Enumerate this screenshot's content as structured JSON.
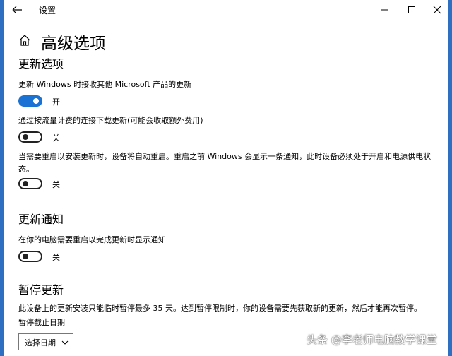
{
  "window": {
    "title": "设置"
  },
  "header": {
    "page_title": "高级选项"
  },
  "update_options": {
    "heading": "更新选项",
    "items": [
      {
        "description": "更新 Windows 时接收其他 Microsoft 产品的更新",
        "state": "on",
        "state_label": "开"
      },
      {
        "description": "通过按流量计费的连接下载更新(可能会收取额外费用)",
        "state": "off",
        "state_label": "关"
      },
      {
        "description": "当需要重启以安装更新时，设备将自动重启。重启之前 Windows 会显示一条通知，此时设备必须处于开启和电源供电状态。",
        "state": "off",
        "state_label": "关"
      }
    ]
  },
  "update_notifications": {
    "heading": "更新通知",
    "items": [
      {
        "description": "在你的电脑需要重启以完成更新时显示通知",
        "state": "off",
        "state_label": "关"
      }
    ]
  },
  "pause_updates": {
    "heading": "暂停更新",
    "description": "此设备上的更新安装只能临时暂停最多 35 天。达到暂停限制时，你的设备需要先获取新的更新，然后才能再次暂停。",
    "date_label": "暂停截止日期",
    "select_value": "选择日期"
  },
  "watermark": "头条 @李老师电脑教学课堂",
  "colors": {
    "accent": "#1a73d4",
    "desktop_edge": "#2e6fc2"
  }
}
